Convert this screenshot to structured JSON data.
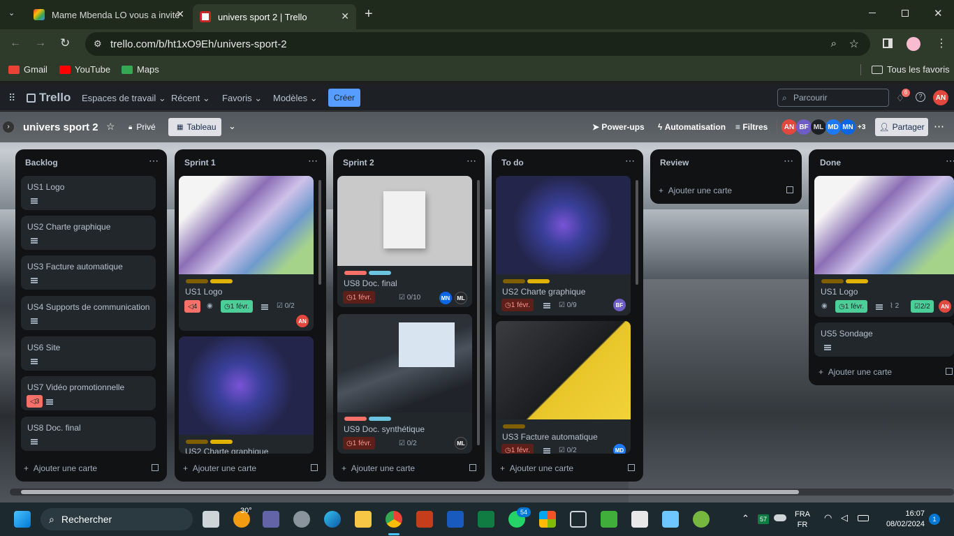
{
  "browser": {
    "tabs": [
      {
        "title": "Mame Mbenda LO vous a invité"
      },
      {
        "title": "univers sport 2 | Trello"
      }
    ],
    "url": "trello.com/b/ht1xO9Eh/univers-sport-2",
    "bookmarks": [
      "Gmail",
      "YouTube",
      "Maps"
    ],
    "all_bookmarks": "Tous les favoris"
  },
  "trello": {
    "logo": "Trello",
    "nav": [
      "Espaces de travail",
      "Récent",
      "Favoris",
      "Modèles"
    ],
    "create": "Créer",
    "search_placeholder": "Parcourir",
    "notif_count": "6",
    "user": "AN"
  },
  "board": {
    "title": "univers sport 2",
    "visibility": "Privé",
    "view": "Tableau",
    "powerups": "Power-ups",
    "automation": "Automatisation",
    "filters": "Filtres",
    "members": [
      "AN",
      "BF",
      "ML",
      "MD",
      "MN"
    ],
    "more_members": "+3",
    "share": "Partager"
  },
  "add_card": "Ajouter une carte",
  "lists": {
    "backlog": {
      "title": "Backlog",
      "cards": [
        "US1 Logo",
        "US2 Charte graphique",
        "US3 Facture automatique",
        "US4 Supports de communication",
        "US6 Site",
        "US7 Vidéo promotionnelle",
        "US8 Doc. final"
      ],
      "us7_votes": "3"
    },
    "sprint1": {
      "title": "Sprint 1",
      "c1": {
        "title": "US1 Logo",
        "votes": "4",
        "due": "1 févr.",
        "check": "0/2",
        "member": "AN"
      },
      "c2": {
        "title": "US2 Charte graphique"
      }
    },
    "sprint2": {
      "title": "Sprint 2",
      "c1": {
        "title": "US8 Doc. final",
        "due": "1 févr.",
        "check": "0/10",
        "m1": "MN",
        "m2": "ML"
      },
      "c2": {
        "title": "US9 Doc. synthétique",
        "due": "1 févr.",
        "check": "0/2",
        "member": "ML"
      }
    },
    "todo": {
      "title": "To do",
      "c1": {
        "title": "US2 Charte graphique",
        "due": "1 févr.",
        "check": "0/9",
        "member": "BF"
      },
      "c2": {
        "title": "US3 Facture automatique",
        "due": "1 févr.",
        "check": "0/2",
        "member": "MD"
      }
    },
    "review": {
      "title": "Review"
    },
    "done": {
      "title": "Done",
      "c1": {
        "title": "US1 Logo",
        "due": "1 févr.",
        "attach": "2",
        "check": "2/2",
        "member": "AN"
      },
      "c2": {
        "title": "US5 Sondage"
      }
    }
  },
  "taskbar": {
    "search": "Rechercher",
    "weather": "30°",
    "whatsapp_badge": "54",
    "tray_badge": "57",
    "lang1": "FRA",
    "lang2": "FR",
    "time": "16:07",
    "date": "08/02/2024",
    "notif": "1"
  },
  "colors": {
    "accent": "#579dff",
    "due_red": "#f87168",
    "due_green": "#4bce97",
    "label_olive": "#7f5f01",
    "label_yellow": "#e2b203",
    "label_red": "#f87168",
    "label_blue": "#6cc3e0"
  }
}
